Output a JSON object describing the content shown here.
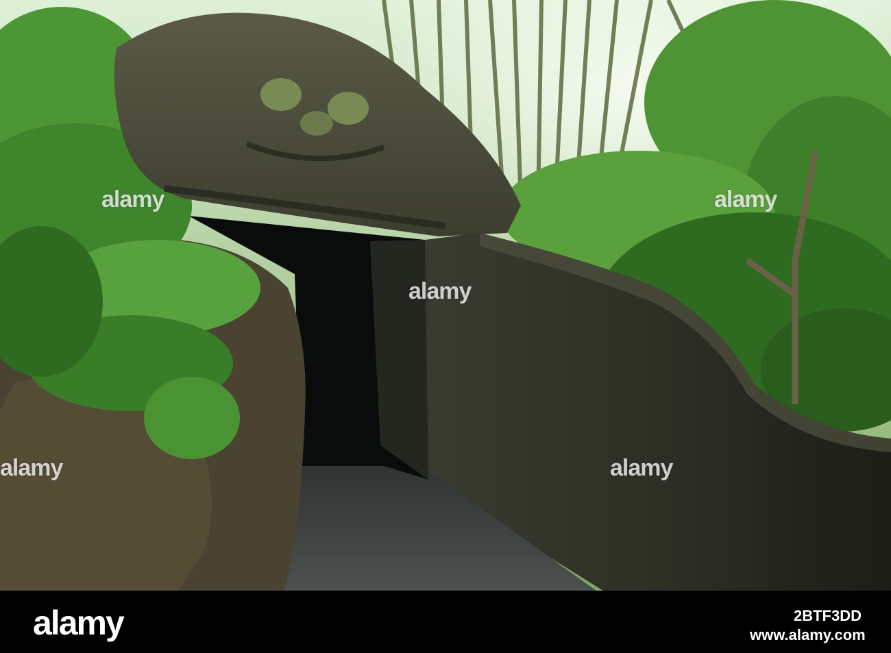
{
  "photo": {
    "watermarks": [
      "alamy",
      "alamy",
      "alamy",
      "alamy",
      "alamy"
    ],
    "palette": {
      "foliage": "#3f7d2b",
      "stone": "#4a4a3a",
      "tunnel": "#0b0d0c",
      "sky": "#e9f3e3"
    }
  },
  "footer": {
    "brand": "alamy",
    "image_id": "2BTF3DD",
    "url": "www.alamy.com"
  }
}
